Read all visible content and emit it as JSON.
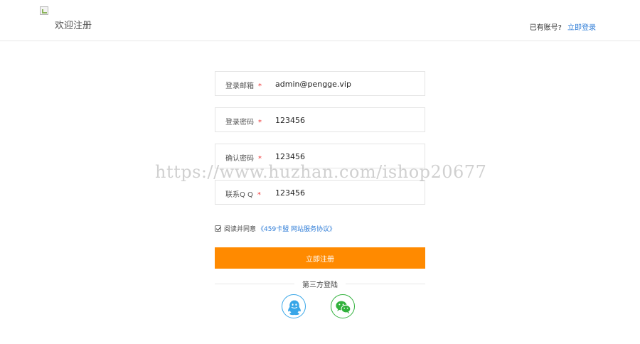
{
  "header": {
    "site_title": "欢迎注册",
    "login_prompt": "已有账号?",
    "login_link": "立即登录"
  },
  "form": {
    "fields": [
      {
        "label": "登录邮箱",
        "required_mark": "*",
        "value": "admin@pengge.vip"
      },
      {
        "label": "登录密码",
        "required_mark": "*",
        "value": "123456"
      },
      {
        "label": "确认密码",
        "required_mark": "*",
        "value": "123456"
      },
      {
        "label": "联系Q Q",
        "required_mark": "*",
        "value": "123456"
      }
    ],
    "agree_text": "阅读并同意",
    "agree_link": "《459卡盟 网站服务协议》",
    "submit_label": "立即注册"
  },
  "third_party": {
    "label": "第三方登陆",
    "providers": [
      "qq-icon",
      "wechat-icon"
    ]
  },
  "watermark": "https://www.huzhan.com/ishop20677",
  "colors": {
    "accent": "#ff8a00",
    "link": "#2e7cd7",
    "required": "#e33333",
    "qq": "#38a6e8",
    "wechat": "#31b13c"
  }
}
